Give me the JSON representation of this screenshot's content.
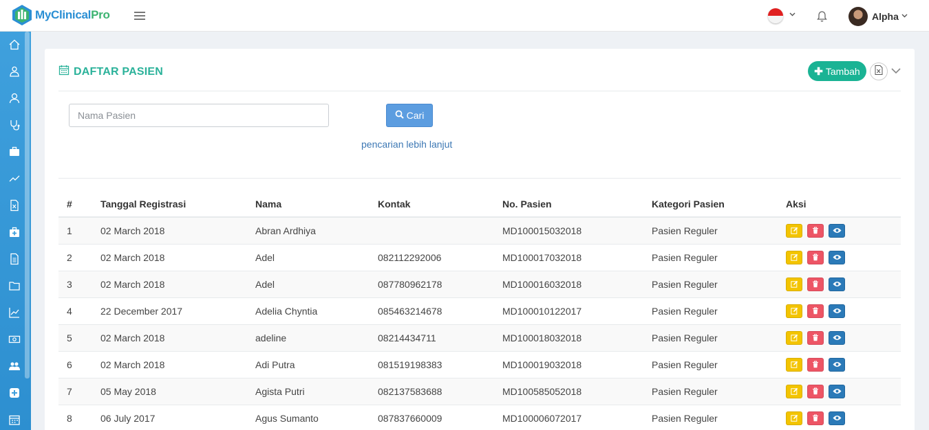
{
  "app": {
    "logo_part1": "MyClinical",
    "logo_part2": "Pro"
  },
  "header": {
    "user_name": "Alpha"
  },
  "page": {
    "title": "DAFTAR PASIEN",
    "add_button": "Tambah"
  },
  "search": {
    "placeholder": "Nama Pasien",
    "button_label": "Cari",
    "advanced_link": "pencarian lebih lanjut"
  },
  "table": {
    "columns": [
      "#",
      "Tanggal Registrasi",
      "Nama",
      "Kontak",
      "No. Pasien",
      "Kategori Pasien",
      "Aksi"
    ],
    "rows": [
      {
        "no": "1",
        "date": "02 March 2018",
        "name": "Abran Ardhiya",
        "contact": "",
        "patient_no": "MD100015032018",
        "category": "Pasien Reguler"
      },
      {
        "no": "2",
        "date": "02 March 2018",
        "name": "Adel",
        "contact": "082112292006",
        "patient_no": "MD100017032018",
        "category": "Pasien Reguler"
      },
      {
        "no": "3",
        "date": "02 March 2018",
        "name": "Adel",
        "contact": "087780962178",
        "patient_no": "MD100016032018",
        "category": "Pasien Reguler"
      },
      {
        "no": "4",
        "date": "22 December 2017",
        "name": "Adelia Chyntia",
        "contact": "085463214678",
        "patient_no": "MD100010122017",
        "category": "Pasien Reguler"
      },
      {
        "no": "5",
        "date": "02 March 2018",
        "name": "adeline",
        "contact": "08214434711",
        "patient_no": "MD100018032018",
        "category": "Pasien Reguler"
      },
      {
        "no": "6",
        "date": "02 March 2018",
        "name": "Adi Putra",
        "contact": "081519198383",
        "patient_no": "MD100019032018",
        "category": "Pasien Reguler"
      },
      {
        "no": "7",
        "date": "05 May 2018",
        "name": "Agista Putri",
        "contact": "082137583688",
        "patient_no": "MD100585052018",
        "category": "Pasien Reguler"
      },
      {
        "no": "8",
        "date": "06 July 2017",
        "name": "Agus Sumanto",
        "contact": "087837660009",
        "patient_no": "MD100006072017",
        "category": "Pasien Reguler"
      }
    ]
  },
  "icons": {
    "sidebar": [
      "home-icon",
      "doctor-icon",
      "patient-icon",
      "stethoscope-icon",
      "briefcase-icon",
      "trend-icon",
      "excel-file-icon",
      "medical-kit-icon",
      "document-icon",
      "folder-icon",
      "chart-icon",
      "money-icon",
      "group-icon",
      "plus-icon",
      "calendar-icon"
    ],
    "actions": [
      "edit-icon",
      "delete-icon",
      "view-icon"
    ]
  },
  "colors": {
    "accent": "#1ab394",
    "title": "#2bb29a",
    "sidebar": "#3fa0dd",
    "search_button": "#5c9de0",
    "edit": "#f3c400",
    "delete": "#ed5565",
    "view": "#2b7ab8"
  }
}
